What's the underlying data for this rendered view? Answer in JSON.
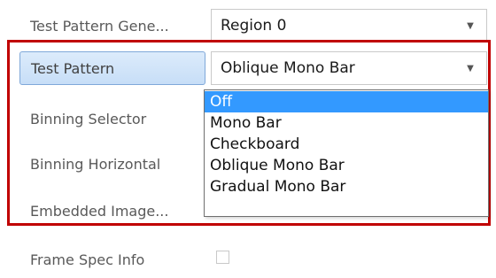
{
  "properties": [
    {
      "label": "Test Pattern Gene...",
      "value": "Region 0",
      "has_dropdown": true
    },
    {
      "label": "Test Pattern",
      "value": "Oblique Mono Bar",
      "has_dropdown": true,
      "selected": true
    },
    {
      "label": "Binning Selector"
    },
    {
      "label": "Binning Horizontal"
    },
    {
      "label": "Embedded Image..."
    },
    {
      "label": "Frame Spec Info",
      "checkbox": false
    }
  ],
  "dropdown": {
    "options": [
      "Off",
      "Mono Bar",
      "Checkboard",
      "Oblique Mono Bar",
      "Gradual Mono Bar"
    ],
    "highlighted": "Off"
  },
  "icons": {
    "dropdown_arrow": "chevron-down-icon",
    "arrow_glyph": "▼"
  },
  "colors": {
    "highlight_frame": "#c00000",
    "selection_blue": "#3399ff",
    "selected_label_bg": "#c7def7"
  }
}
